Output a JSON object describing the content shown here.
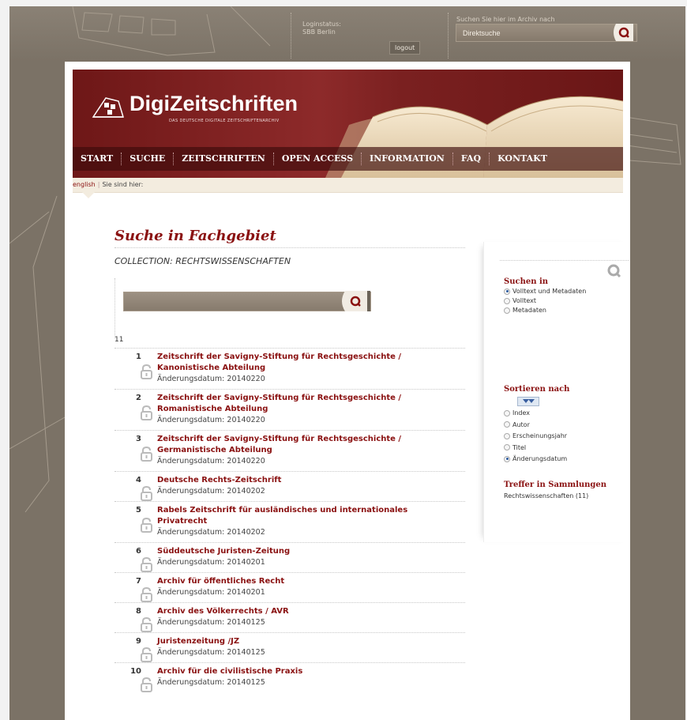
{
  "header": {
    "login_label": "Loginstatus:",
    "login_user": "SBB Berlin",
    "logout": "logout",
    "search_label": "Suchen Sie hier im Archiv nach",
    "search_value": "Direktsuche"
  },
  "logo": {
    "name": "DigiZeitschriften",
    "subtitle": "DAS DEUTSCHE DIGITALE ZEITSCHRIFTENARCHIV"
  },
  "nav": [
    "START",
    "SUCHE",
    "ZEITSCHRIFTEN",
    "OPEN ACCESS",
    "INFORMATION",
    "FAQ",
    "KONTAKT"
  ],
  "breadcrumb": {
    "lang": "english",
    "here": "Sie sind hier:"
  },
  "main": {
    "title": "Suche in Fachgebiet",
    "collection": "COLLECTION: RECHTSWISSENSCHAFTEN",
    "count": "11",
    "date_label": "Änderungsdatum:"
  },
  "results": [
    {
      "n": "1",
      "title": "Zeitschrift der Savigny-Stiftung für Rechtsgeschichte / Kanonistische Abteilung",
      "date": "20140220"
    },
    {
      "n": "2",
      "title": "Zeitschrift der Savigny-Stiftung für Rechtsgeschichte / Romanistische Abteilung",
      "date": "20140220"
    },
    {
      "n": "3",
      "title": "Zeitschrift der Savigny-Stiftung für Rechtsgeschichte / Germanistische Abteilung",
      "date": "20140220"
    },
    {
      "n": "4",
      "title": "Deutsche Rechts-Zeitschrift",
      "date": "20140202"
    },
    {
      "n": "5",
      "title": "Rabels Zeitschrift für ausländisches und internationales Privatrecht",
      "date": "20140202"
    },
    {
      "n": "6",
      "title": "Süddeutsche Juristen-Zeitung",
      "date": "20140201"
    },
    {
      "n": "7",
      "title": "Archiv für öffentliches Recht",
      "date": "20140201"
    },
    {
      "n": "8",
      "title": "Archiv des Völkerrechts / AVR",
      "date": "20140125"
    },
    {
      "n": "9",
      "title": "Juristenzeitung /JZ",
      "date": "20140125"
    },
    {
      "n": "10",
      "title": "Archiv für die civilistische Praxis",
      "date": "20140125"
    }
  ],
  "sidebar": {
    "search_in_title": "Suchen in",
    "search_in_options": [
      {
        "label": "Volltext und Metadaten",
        "checked": true
      },
      {
        "label": "Volltext",
        "checked": false
      },
      {
        "label": "Metadaten",
        "checked": false
      }
    ],
    "sort_title": "Sortieren nach",
    "sort_options": [
      {
        "label": "Index",
        "checked": false
      },
      {
        "label": "Autor",
        "checked": false
      },
      {
        "label": "Erscheinungsjahr",
        "checked": false
      },
      {
        "label": "Titel",
        "checked": false
      },
      {
        "label": "Änderungsdatum",
        "checked": true
      }
    ],
    "hits_title": "Treffer in Sammlungen",
    "hits_value": "Rechtswissenschaften (11)"
  },
  "colors": {
    "brand_red": "#8a1111",
    "background_brown": "#7b7266"
  }
}
